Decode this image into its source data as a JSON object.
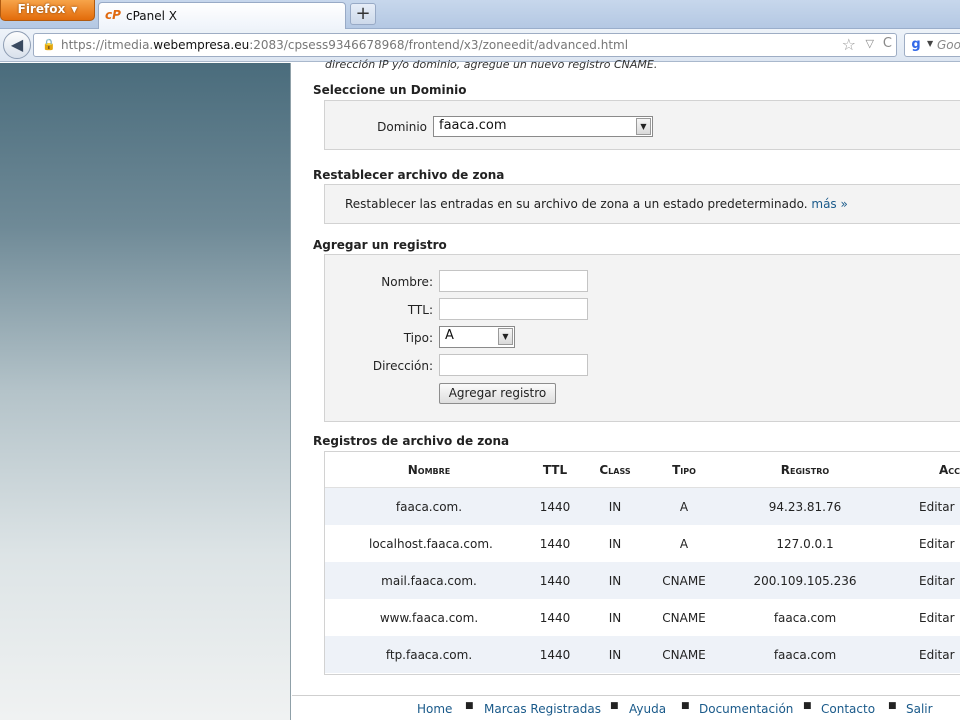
{
  "browser": {
    "firefox_button": "Firefox",
    "tab_title": "cPanel X",
    "tab_logo": "cP",
    "new_tab": "+",
    "url_prefix": "https://itmedia.",
    "url_domain": "webempresa.eu",
    "url_suffix": ":2083/cpsess9346678968/frontend/x3/zoneedit/advanced.html",
    "search_engine_text": "Goo"
  },
  "page": {
    "intro": "dirección IP y/o dominio, agregue un nuevo registro CNAME.",
    "select_domain": {
      "title": "Seleccione un Dominio",
      "label": "Dominio",
      "value": "faaca.com"
    },
    "reset_zone": {
      "title": "Restablecer archivo de zona",
      "text": "Restablecer las entradas en su archivo de zona a un estado predeterminado.",
      "more_link": "más »"
    },
    "add_record": {
      "title": "Agregar un registro",
      "name_label": "Nombre:",
      "name_value": "",
      "ttl_label": "TTL:",
      "ttl_value": "",
      "type_label": "Tipo:",
      "type_value": "A",
      "address_label": "Dirección:",
      "address_value": "",
      "submit_label": "Agregar registro"
    },
    "zone_records": {
      "title": "Registros de archivo de zona",
      "columns": [
        "Nombre",
        "TTL",
        "Class",
        "Tipo",
        "Registro",
        "Acc"
      ],
      "rows": [
        {
          "name": "faaca.com.",
          "ttl": "1440",
          "class": "IN",
          "type": "A",
          "record": "94.23.81.76",
          "action": "Editar"
        },
        {
          "name": "localhost.faaca.com.",
          "ttl": "1440",
          "class": "IN",
          "type": "A",
          "record": "127.0.0.1",
          "action": "Editar"
        },
        {
          "name": "mail.faaca.com.",
          "ttl": "1440",
          "class": "IN",
          "type": "CNAME",
          "record": "200.109.105.236",
          "action": "Editar"
        },
        {
          "name": "www.faaca.com.",
          "ttl": "1440",
          "class": "IN",
          "type": "CNAME",
          "record": "faaca.com",
          "action": "Editar"
        },
        {
          "name": "ftp.faaca.com.",
          "ttl": "1440",
          "class": "IN",
          "type": "CNAME",
          "record": "faaca.com",
          "action": "Editar"
        }
      ]
    },
    "footer": [
      "Home",
      "Marcas Registradas",
      "Ayuda",
      "Documentación",
      "Contacto",
      "Salir"
    ]
  }
}
